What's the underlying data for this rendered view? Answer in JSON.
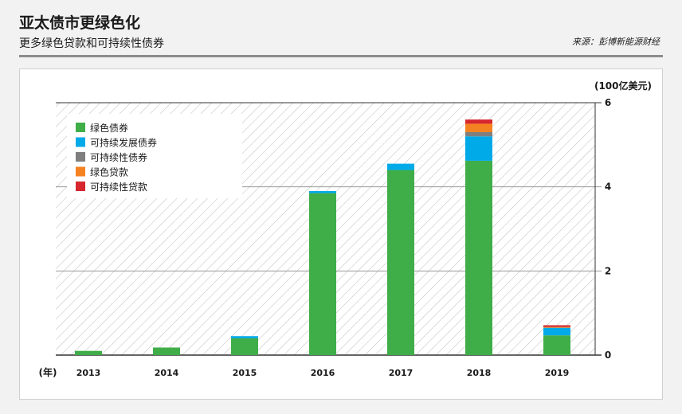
{
  "header": {
    "title": "亚太债市更绿色化",
    "subtitle": "更多绿色贷款和可持续性债券",
    "source": "来源：彭博新能源财经"
  },
  "chart_data": {
    "type": "bar",
    "stacked": true,
    "categories": [
      "2013",
      "2014",
      "2015",
      "2016",
      "2017",
      "2018",
      "2019"
    ],
    "xlabel": "(年)",
    "ylabel": "(100亿美元)",
    "ylim": [
      0,
      6
    ],
    "yticks": [
      0,
      2,
      4,
      6
    ],
    "grid": true,
    "legend_position": "top-left",
    "series": [
      {
        "name": "绿色债券",
        "color": "#3fae49",
        "values": [
          0.1,
          0.18,
          0.4,
          3.85,
          4.4,
          4.62,
          0.47
        ]
      },
      {
        "name": "可持续发展债券",
        "color": "#00a9e8",
        "values": [
          0,
          0,
          0.05,
          0.05,
          0.15,
          0.58,
          0.18
        ]
      },
      {
        "name": "可持续性债券",
        "color": "#7f7f7f",
        "values": [
          0,
          0,
          0,
          0,
          0,
          0.1,
          0
        ]
      },
      {
        "name": "绿色贷款",
        "color": "#f58220",
        "values": [
          0,
          0,
          0,
          0,
          0,
          0.2,
          0.02
        ]
      },
      {
        "name": "可持续性贷款",
        "color": "#d7262e",
        "values": [
          0,
          0,
          0,
          0,
          0,
          0.1,
          0.04
        ]
      }
    ]
  }
}
